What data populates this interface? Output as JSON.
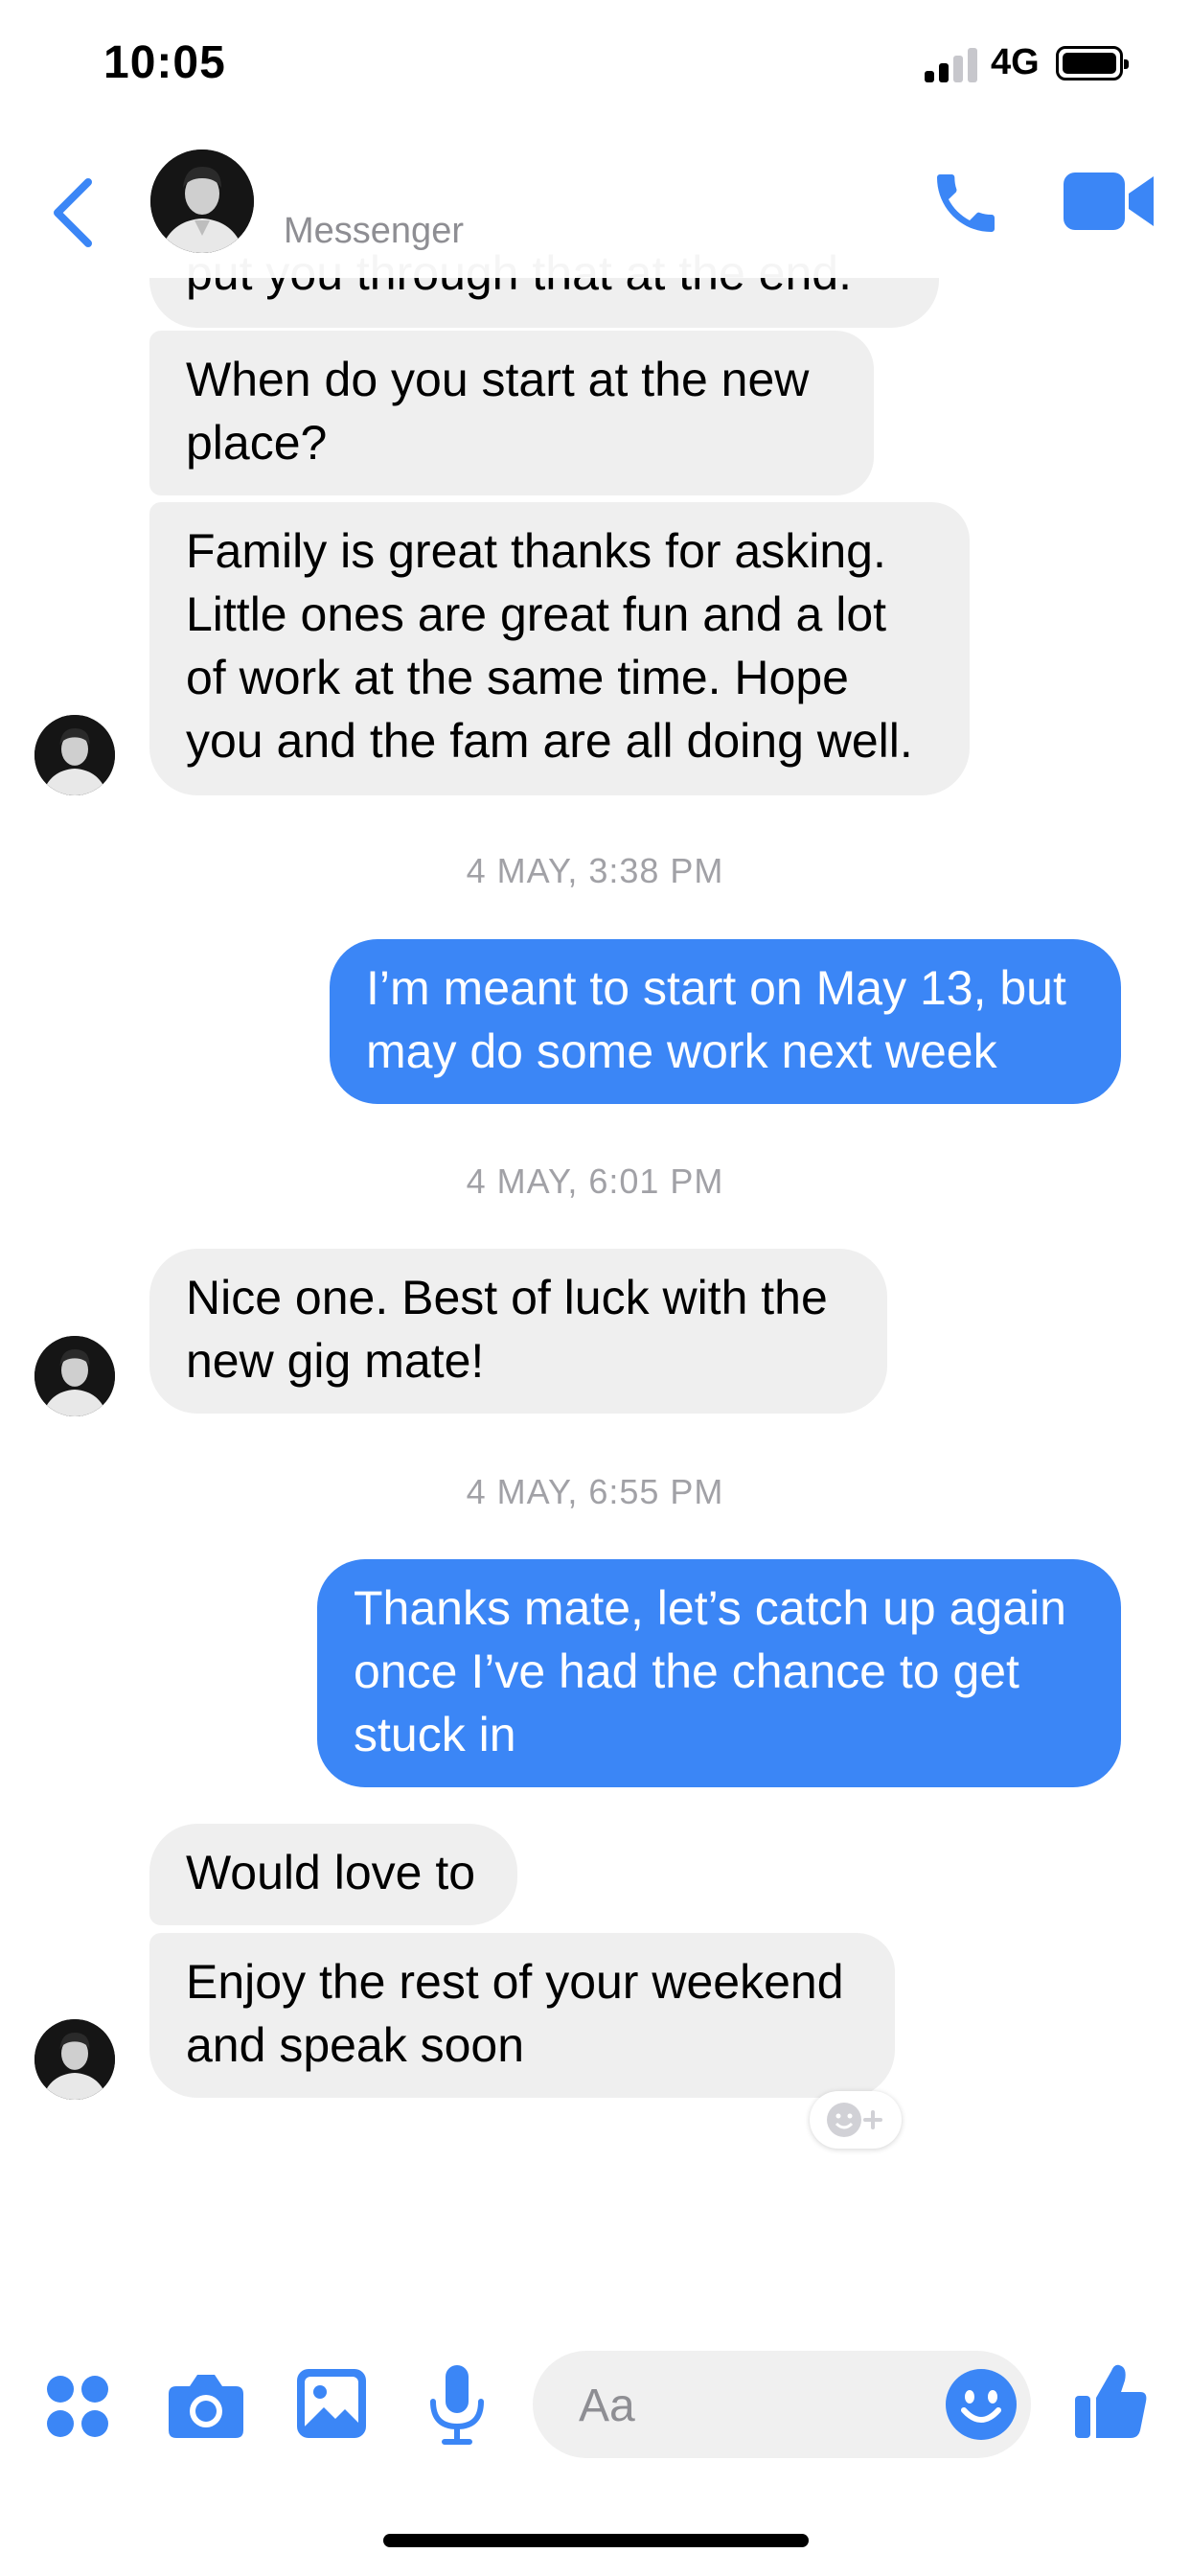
{
  "status_bar": {
    "time": "10:05",
    "network": "4G"
  },
  "header": {
    "subtitle": "Messenger"
  },
  "messages": [
    {
      "dir": "in",
      "text": "put you through that at the end."
    },
    {
      "dir": "in",
      "text": "When do you start at the new place?"
    },
    {
      "dir": "in",
      "text": "Family is great thanks for asking. Little ones are great fun and a lot of work at the same time. Hope you and the fam are all doing well."
    },
    {
      "dir": "out",
      "text": "I’m meant to start on May 13, but may do some work next week"
    },
    {
      "dir": "in",
      "text": "Nice one. Best of luck with the new gig mate!"
    },
    {
      "dir": "out",
      "text": "Thanks mate, let’s catch up again once I’ve had the chance to get stuck in"
    },
    {
      "dir": "in",
      "text": "Would love to"
    },
    {
      "dir": "in",
      "text": "Enjoy the rest of your weekend and speak soon"
    }
  ],
  "timestamps": [
    "4 MAY, 3:38 PM",
    "4 MAY, 6:01 PM",
    "4 MAY, 6:55 PM"
  ],
  "composer": {
    "placeholder": "Aa"
  },
  "colors": {
    "accent": "#3b86f6",
    "incoming_bubble": "#efefef",
    "timestamp": "#a1a1a6"
  },
  "icons": [
    "back-chevron-icon",
    "phone-icon",
    "video-camera-icon",
    "apps-grid-icon",
    "camera-icon",
    "gallery-icon",
    "microphone-icon",
    "emoji-icon",
    "thumbs-up-icon",
    "add-reaction-icon"
  ]
}
